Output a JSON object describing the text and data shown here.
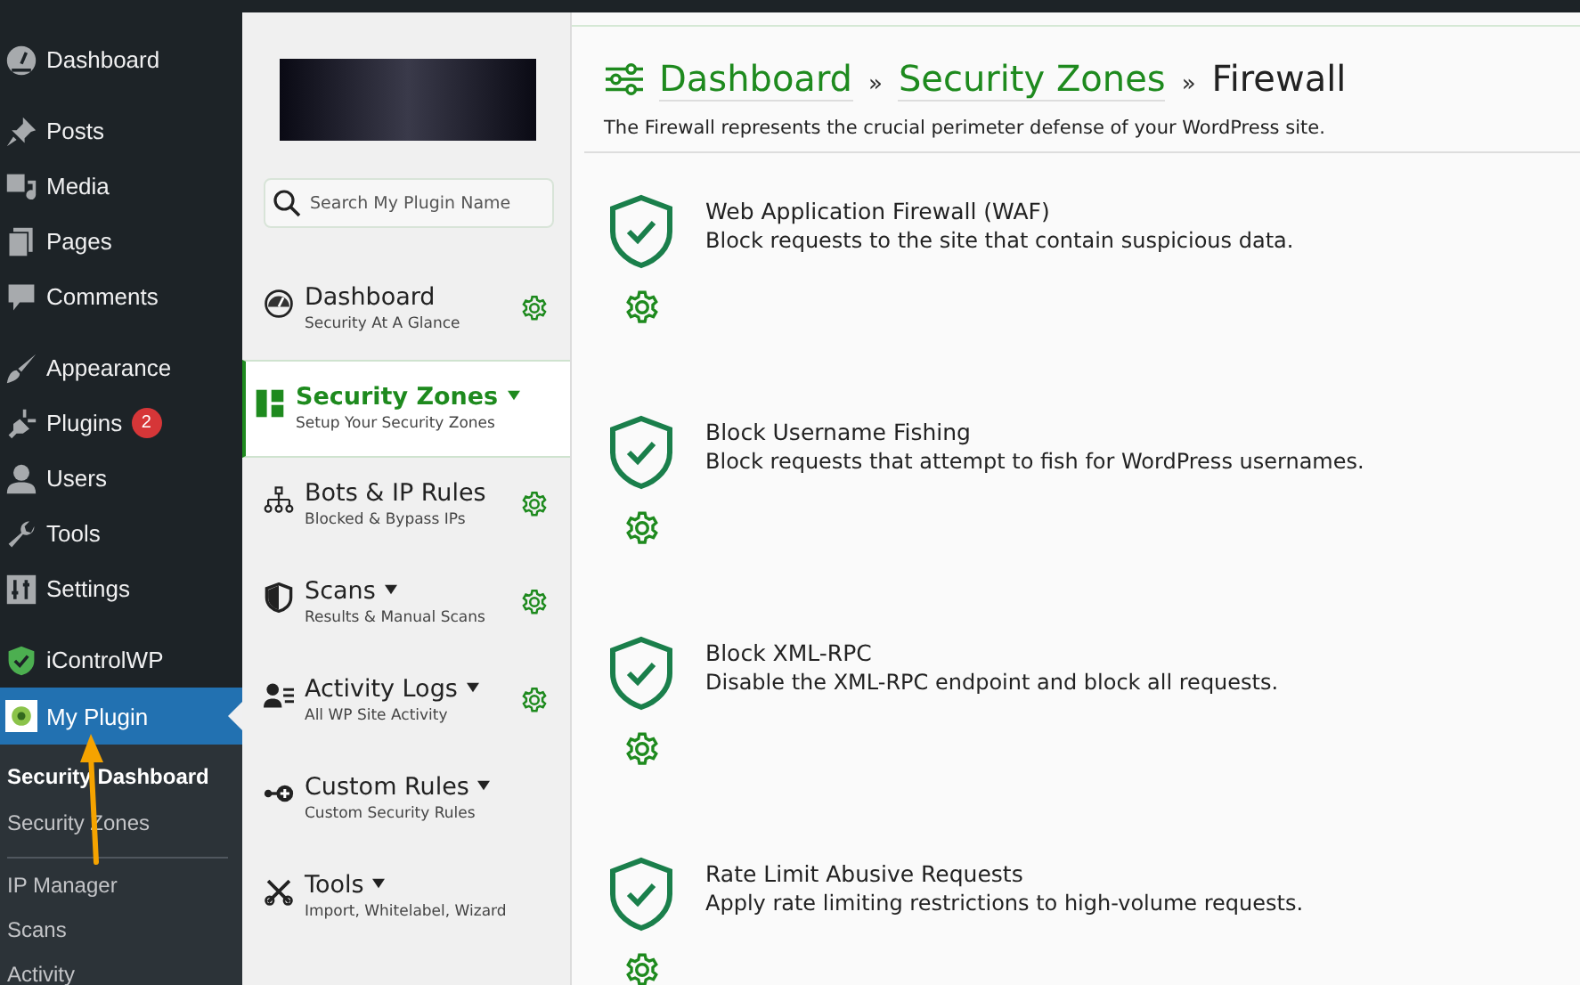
{
  "admin_menu": {
    "groups": [
      [
        {
          "label": "Dashboard",
          "selected": false
        }
      ],
      [
        {
          "label": "Posts",
          "selected": false
        },
        {
          "label": "Media",
          "selected": false
        },
        {
          "label": "Pages",
          "selected": false
        },
        {
          "label": "Comments",
          "selected": false
        }
      ],
      [
        {
          "label": "Appearance",
          "selected": false
        },
        {
          "label": "Plugins",
          "selected": false,
          "badge": "2"
        },
        {
          "label": "Users",
          "selected": false
        },
        {
          "label": "Tools",
          "selected": false
        },
        {
          "label": "Settings",
          "selected": false
        }
      ],
      [
        {
          "label": "iControlWP",
          "selected": false
        },
        {
          "label": "My Plugin",
          "selected": true
        }
      ]
    ],
    "submenu": [
      [
        {
          "label": "Security Dashboard",
          "selected": true
        },
        {
          "label": "Security Zones",
          "selected": false
        }
      ],
      [
        {
          "label": "IP Manager",
          "selected": false
        },
        {
          "label": "Scans",
          "selected": false
        },
        {
          "label": "Activity",
          "selected": false
        }
      ]
    ]
  },
  "plugin_nav": {
    "search": {
      "placeholder": "Search My Plugin Name"
    },
    "items": [
      {
        "title": "Dashboard",
        "subtitle": "Security At A Glance",
        "selected": false,
        "has_menu": false,
        "settings": true
      },
      {
        "title": "Security Zones",
        "subtitle": "Setup Your Security Zones",
        "selected": true,
        "has_menu": true,
        "settings": false
      },
      {
        "title": "Bots & IP Rules",
        "subtitle": "Blocked & Bypass IPs",
        "selected": false,
        "has_menu": false,
        "settings": true
      },
      {
        "title": "Scans",
        "subtitle": "Results & Manual Scans",
        "selected": false,
        "has_menu": true,
        "settings": true
      },
      {
        "title": "Activity Logs",
        "subtitle": "All WP Site Activity",
        "selected": false,
        "has_menu": true,
        "settings": true
      },
      {
        "title": "Custom Rules",
        "subtitle": "Custom Security Rules",
        "selected": false,
        "has_menu": true,
        "settings": false
      },
      {
        "title": "Tools",
        "subtitle": "Import, Whitelabel, Wizard",
        "selected": false,
        "has_menu": true,
        "settings": false
      }
    ]
  },
  "main": {
    "breadcrumb": [
      {
        "label": "Dashboard",
        "separator": "»"
      },
      {
        "label": "Security Zones",
        "separator": "»"
      }
    ],
    "title": "Firewall",
    "description": "The Firewall represents the crucial perimeter defense of your WordPress site.",
    "features": [
      {
        "title": "Web Application Firewall (WAF)",
        "description": "Block requests to the site that contain suspicious data."
      },
      {
        "title": "Block Username Fishing",
        "description": "Block requests that attempt to fish for WordPress usernames."
      },
      {
        "title": "Block XML-RPC",
        "description": "Disable the XML-RPC endpoint and block all requests."
      },
      {
        "title": "Rate Limit Abusive Requests",
        "description": "Apply rate limiting restrictions to high-volume requests."
      }
    ]
  }
}
